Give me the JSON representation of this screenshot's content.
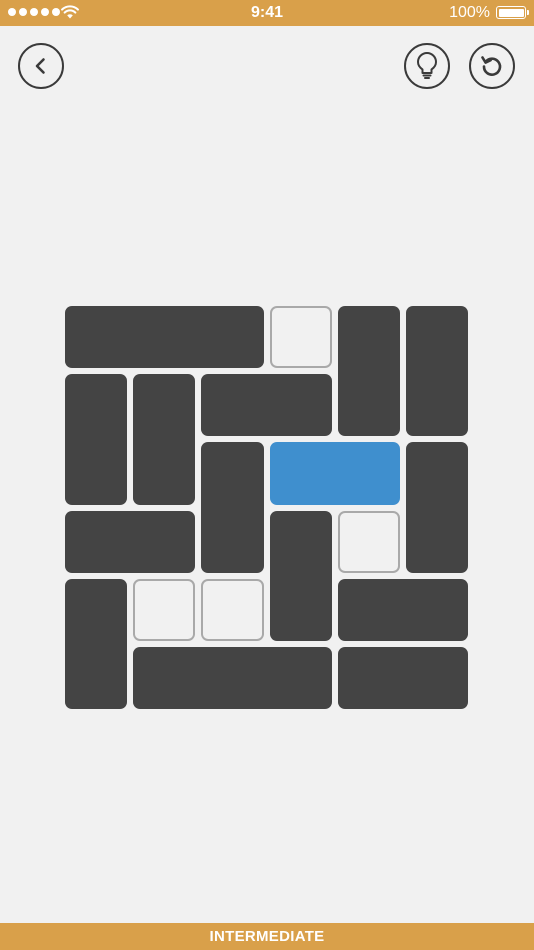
{
  "theme": {
    "accent": "#d9a04a",
    "background": "#f1f1f1",
    "block_dark": "#444444",
    "block_target": "#3f8fce",
    "empty_border": "#a9a9a9",
    "icon_stroke": "#3a3a3a"
  },
  "status_bar": {
    "time": "9:41",
    "battery_text": "100%",
    "signal_icon": "signal-dots-icon",
    "wifi_icon": "wifi-icon",
    "battery_icon": "battery-icon"
  },
  "header": {
    "back_icon": "chevron-left-icon",
    "hint_icon": "lightbulb-icon",
    "restart_icon": "restart-icon"
  },
  "board": {
    "columns": 6,
    "rows": 6,
    "pieces": [
      {
        "col": 0,
        "row": 0,
        "w": 3,
        "h": 1,
        "kind": "wall"
      },
      {
        "col": 3,
        "row": 0,
        "w": 1,
        "h": 1,
        "kind": "empty"
      },
      {
        "col": 4,
        "row": 0,
        "w": 1,
        "h": 2,
        "kind": "wall"
      },
      {
        "col": 5,
        "row": 0,
        "w": 1,
        "h": 2,
        "kind": "wall"
      },
      {
        "col": 0,
        "row": 1,
        "w": 1,
        "h": 2,
        "kind": "wall"
      },
      {
        "col": 1,
        "row": 1,
        "w": 1,
        "h": 2,
        "kind": "wall"
      },
      {
        "col": 2,
        "row": 1,
        "w": 2,
        "h": 1,
        "kind": "wall"
      },
      {
        "col": 2,
        "row": 2,
        "w": 1,
        "h": 2,
        "kind": "wall"
      },
      {
        "col": 3,
        "row": 2,
        "w": 2,
        "h": 1,
        "kind": "target"
      },
      {
        "col": 5,
        "row": 2,
        "w": 1,
        "h": 2,
        "kind": "wall"
      },
      {
        "col": 0,
        "row": 3,
        "w": 2,
        "h": 1,
        "kind": "wall"
      },
      {
        "col": 3,
        "row": 3,
        "w": 1,
        "h": 2,
        "kind": "wall"
      },
      {
        "col": 4,
        "row": 3,
        "w": 1,
        "h": 1,
        "kind": "empty"
      },
      {
        "col": 0,
        "row": 4,
        "w": 1,
        "h": 2,
        "kind": "wall"
      },
      {
        "col": 1,
        "row": 4,
        "w": 1,
        "h": 1,
        "kind": "empty"
      },
      {
        "col": 2,
        "row": 4,
        "w": 1,
        "h": 1,
        "kind": "empty"
      },
      {
        "col": 4,
        "row": 4,
        "w": 2,
        "h": 1,
        "kind": "wall"
      },
      {
        "col": 1,
        "row": 5,
        "w": 3,
        "h": 1,
        "kind": "wall"
      },
      {
        "col": 4,
        "row": 5,
        "w": 2,
        "h": 1,
        "kind": "wall"
      }
    ]
  },
  "footer": {
    "level_label": "INTERMEDIATE"
  }
}
